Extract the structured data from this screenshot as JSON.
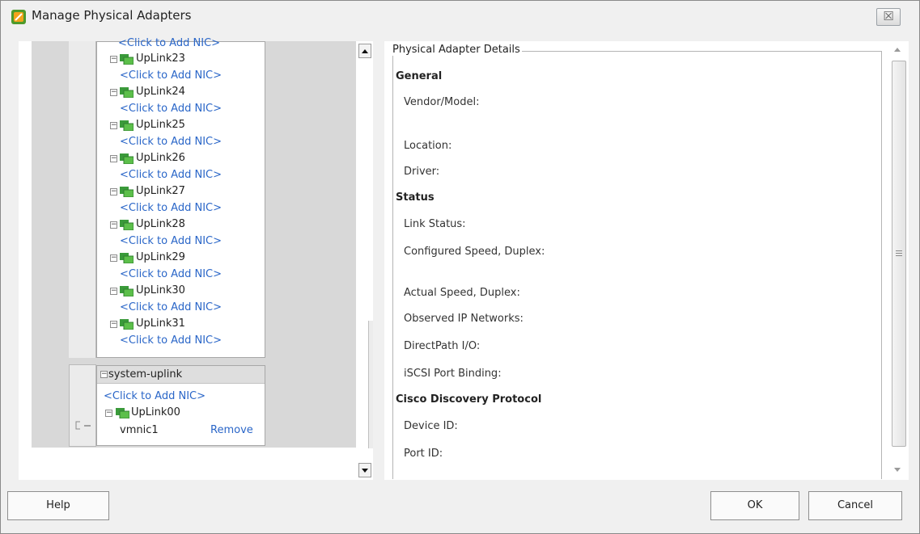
{
  "window": {
    "title": "Manage Physical Adapters",
    "close_glyph": "☒"
  },
  "tree": {
    "cut_top_link": "<Click to Add NIC>",
    "uplinks": [
      {
        "name": "UpLink23",
        "add_link": "<Click to Add NIC>"
      },
      {
        "name": "UpLink24",
        "add_link": "<Click to Add NIC>"
      },
      {
        "name": "UpLink25",
        "add_link": "<Click to Add NIC>"
      },
      {
        "name": "UpLink26",
        "add_link": "<Click to Add NIC>"
      },
      {
        "name": "UpLink27",
        "add_link": "<Click to Add NIC>"
      },
      {
        "name": "UpLink28",
        "add_link": "<Click to Add NIC>"
      },
      {
        "name": "UpLink29",
        "add_link": "<Click to Add NIC>"
      },
      {
        "name": "UpLink30",
        "add_link": "<Click to Add NIC>"
      },
      {
        "name": "UpLink31",
        "add_link": "<Click to Add NIC>"
      }
    ],
    "system_group": {
      "name": "system-uplink",
      "add_link": "<Click to Add NIC>",
      "uplink": "UpLink00",
      "nic": "vmnic1",
      "remove_label": "Remove"
    }
  },
  "details": {
    "legend": "Physical Adapter Details",
    "general": {
      "heading": "General",
      "vendor_model": "Vendor/Model:",
      "location": "Location:",
      "driver": "Driver:"
    },
    "status": {
      "heading": "Status",
      "link_status": "Link Status:",
      "configured_speed": "Configured Speed, Duplex:",
      "actual_speed": "Actual Speed, Duplex:",
      "observed_ip": "Observed IP Networks:",
      "directpath": "DirectPath I/O:",
      "iscsi": "iSCSI Port Binding:"
    },
    "cdp": {
      "heading": "Cisco Discovery Protocol",
      "device_id": "Device ID:",
      "port_id": "Port ID:"
    }
  },
  "buttons": {
    "help": "Help",
    "ok": "OK",
    "cancel": "Cancel"
  },
  "colors": {
    "link": "#2a66c8",
    "nic_icon": "#3a9a3a"
  }
}
